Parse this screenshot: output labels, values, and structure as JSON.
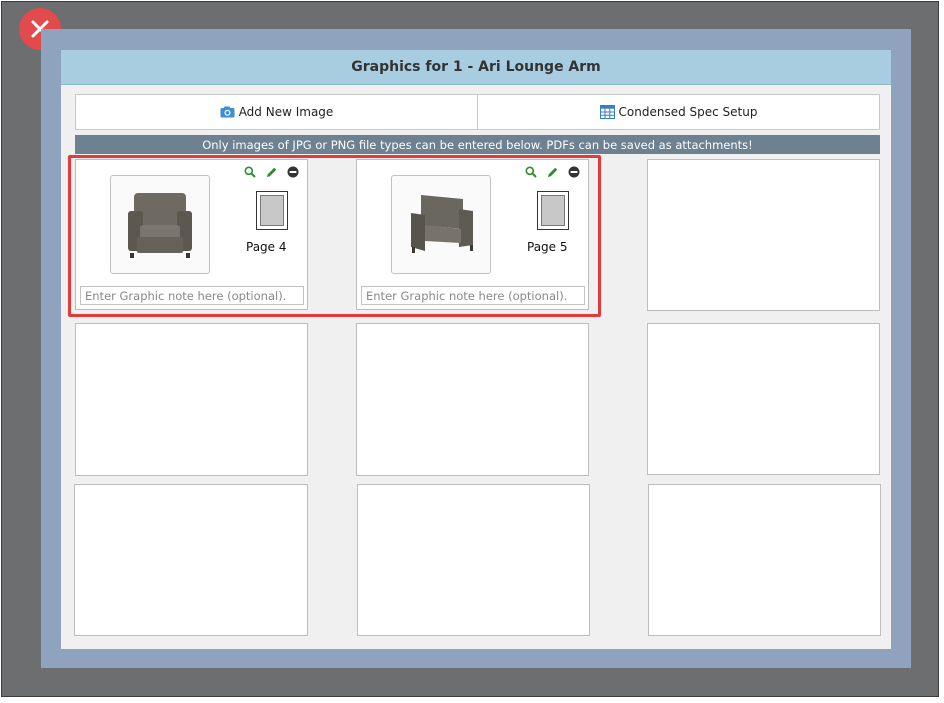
{
  "dialog": {
    "title": "Graphics for 1 - Ari Lounge Arm",
    "close_icon": "close-x-icon"
  },
  "toolbar": {
    "add_image_label": "Add New Image",
    "add_image_icon": "camera-icon",
    "spec_setup_label": "Condensed Spec Setup",
    "spec_setup_icon": "table-grid-icon"
  },
  "notice": "Only images of JPG or PNG file types can be entered below. PDFs can be saved as attachments!",
  "graphics": [
    {
      "page_label": "Page 4",
      "note_value": "",
      "note_placeholder": "Enter Graphic note here (optional)."
    },
    {
      "page_label": "Page 5",
      "note_value": "",
      "note_placeholder": "Enter Graphic note here (optional)."
    }
  ],
  "empty_slots": 7,
  "colors": {
    "close": "#e24b4b",
    "title_bar": "#a9cde0",
    "notice_bar": "#6d8190",
    "highlight": "#e53a3a",
    "icon_green": "#2d8a2d"
  }
}
